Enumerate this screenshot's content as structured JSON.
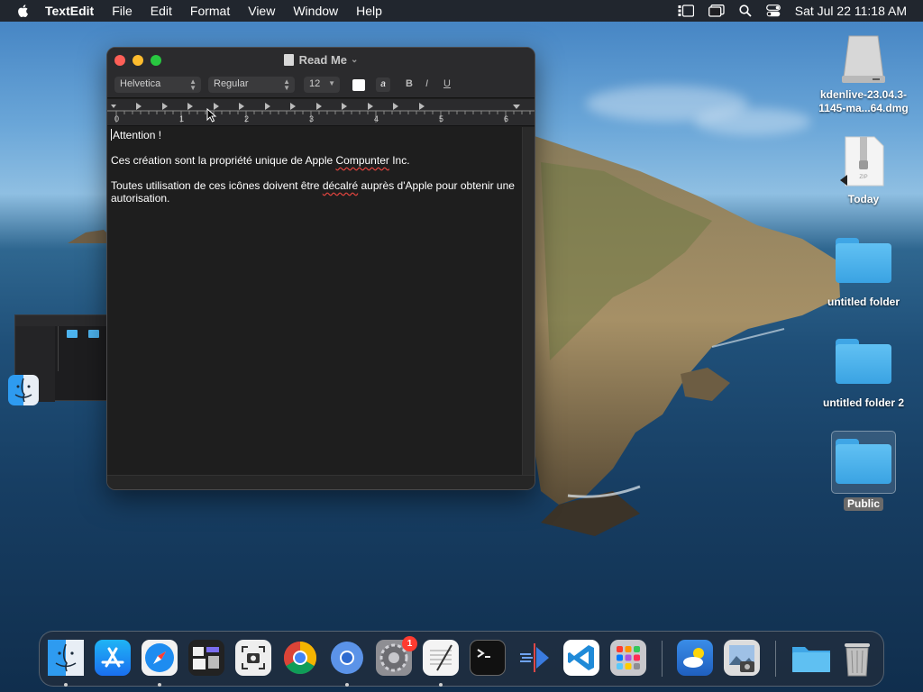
{
  "menubar": {
    "app_name": "TextEdit",
    "menus": [
      "File",
      "Edit",
      "Format",
      "View",
      "Window",
      "Help"
    ],
    "clock": "Sat Jul 22  11:18 AM"
  },
  "window": {
    "title": "Read Me",
    "font_family": "Helvetica",
    "font_style": "Regular",
    "font_size": "12",
    "bold_label": "B",
    "italic_label": "I",
    "underline_label": "U",
    "bg_color_label": "a",
    "ruler_numbers": [
      "0",
      "1",
      "2",
      "3",
      "4",
      "5",
      "6"
    ]
  },
  "document": {
    "line1": "Attention !",
    "line2_before": "Ces création sont la propriété unique de Apple ",
    "line2_misspelled": "Compunter",
    "line2_after": " Inc.",
    "line3_before": "Toutes utilisation de ces icônes doivent être ",
    "line3_misspelled": "décalré",
    "line3_after": " auprès d'Apple pour obtenir une autorisation."
  },
  "desktop": {
    "icons": [
      {
        "label": "kdenlive-23.04.3-1145-ma...64.dmg"
      },
      {
        "label": "Today"
      },
      {
        "label": "untitled folder"
      },
      {
        "label": "untitled folder 2"
      },
      {
        "label": "Public"
      }
    ]
  },
  "dock": {
    "apps": [
      {
        "name": "finder-icon"
      },
      {
        "name": "app-store-icon"
      },
      {
        "name": "safari-icon"
      },
      {
        "name": "mission-control-icon"
      },
      {
        "name": "screenshot-icon"
      },
      {
        "name": "chrome-icon"
      },
      {
        "name": "chromium-icon"
      },
      {
        "name": "system-preferences-icon",
        "badge": "1"
      },
      {
        "name": "textedit-icon"
      },
      {
        "name": "terminal-icon"
      },
      {
        "name": "kdenlive-icon"
      },
      {
        "name": "vscode-icon"
      },
      {
        "name": "launchpad-icon"
      },
      {
        "name": "weather-icon"
      },
      {
        "name": "preview-icon"
      },
      {
        "name": "folder-icon"
      },
      {
        "name": "trash-icon"
      }
    ],
    "badge_count": "1"
  },
  "colors": {
    "accent": "#0a84ff",
    "close": "#fe5f57",
    "minimize": "#febc2e",
    "zoom": "#28c840",
    "folder": "#4db3ee"
  }
}
